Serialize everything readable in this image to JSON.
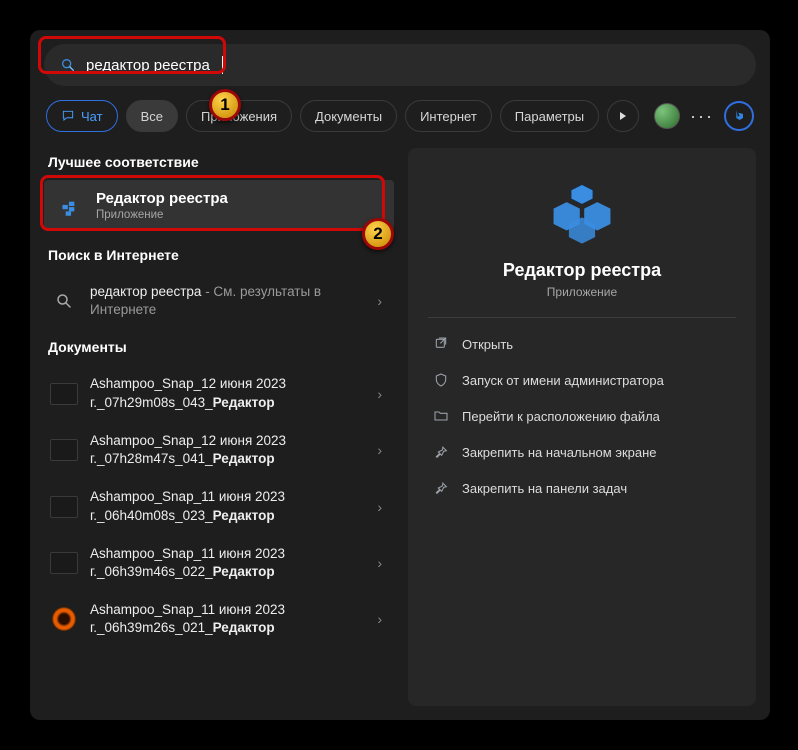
{
  "search": {
    "query": "редактор реестра"
  },
  "filters": {
    "chat": "Чат",
    "all": "Все",
    "apps": "Приложения",
    "docs": "Документы",
    "web": "Интернет",
    "params": "Параметры"
  },
  "sections": {
    "best": "Лучшее соответствие",
    "web": "Поиск в Интернете",
    "docs": "Документы"
  },
  "best_match": {
    "title": "Редактор реестра",
    "subtitle": "Приложение"
  },
  "web_result": {
    "prefix": "редактор реестра",
    "suffix": " - См. результаты в Интернете"
  },
  "documents": [
    {
      "l1": "Ashampoo_Snap_12 июня 2023 г._07h29m08s_043_",
      "bold": "Редактор",
      "thumb": "dark"
    },
    {
      "l1": "Ashampoo_Snap_12 июня 2023 г._07h28m47s_041_",
      "bold": "Редактор",
      "thumb": "dark"
    },
    {
      "l1": "Ashampoo_Snap_11 июня 2023 г._06h40m08s_023_",
      "bold": "Редактор",
      "thumb": "dark"
    },
    {
      "l1": "Ashampoo_Snap_11 июня 2023 г._06h39m46s_022_",
      "bold": "Редактор",
      "thumb": "dark"
    },
    {
      "l1": "Ashampoo_Snap_11 июня 2023 г._06h39m26s_021_",
      "bold": "Редактор",
      "thumb": "orange"
    }
  ],
  "preview": {
    "title": "Редактор реестра",
    "subtitle": "Приложение",
    "actions": {
      "open": "Открыть",
      "admin": "Запуск от имени администратора",
      "location": "Перейти к расположению файла",
      "pin_start": "Закрепить на начальном экране",
      "pin_task": "Закрепить на панели задач"
    }
  },
  "markers": {
    "m1": "1",
    "m2": "2"
  }
}
